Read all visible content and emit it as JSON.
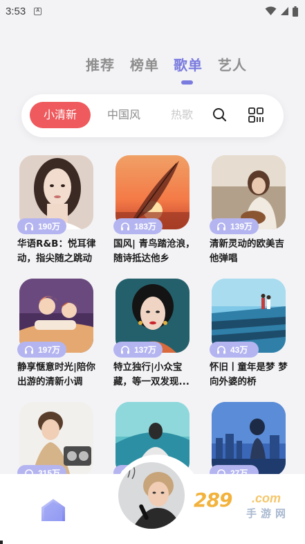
{
  "status_bar": {
    "time": "3:53",
    "notification_letter": "A"
  },
  "top_tabs": [
    {
      "label": "推荐",
      "active": false
    },
    {
      "label": "榜单",
      "active": false
    },
    {
      "label": "歌单",
      "active": true
    },
    {
      "label": "艺人",
      "active": false
    }
  ],
  "filters": {
    "active": "小清新",
    "second": "中国风",
    "third": "热歌"
  },
  "icons": {
    "search": "search-icon",
    "category": "category-grid-icon",
    "headphones": "headphones-icon",
    "home": "home-icon"
  },
  "colors": {
    "accent": "#7a7bde",
    "active_chip": "#ee5a5d",
    "badge": "#b4b5f0"
  },
  "playlists": [
    {
      "plays": "190万",
      "title": "华语R&B：悦耳律动，指尖随之跳动"
    },
    {
      "plays": "183万",
      "title": "国风| 青鸟踏沧浪，随诗抵达他乡"
    },
    {
      "plays": "139万",
      "title": "清新灵动的欧美吉他弹唱"
    },
    {
      "plays": "197万",
      "title": "静享惬意时光|陪你出游的清新小调"
    },
    {
      "plays": "137万",
      "title": "特立独行|小众宝藏，等一双发现..."
    },
    {
      "plays": "43万",
      "title": "怀旧丨童年是梦 梦向外婆的桥"
    },
    {
      "plays": "315万",
      "title": ""
    },
    {
      "plays": "",
      "title": ""
    },
    {
      "plays": "27万",
      "title": ""
    }
  ],
  "watermark": {
    "number": "289",
    "domain": ".com",
    "text": "手游网"
  }
}
